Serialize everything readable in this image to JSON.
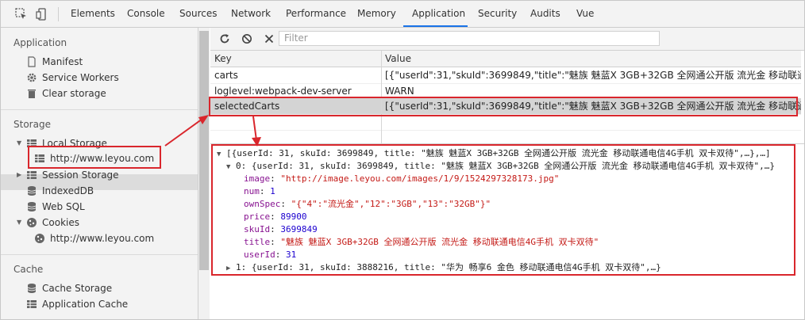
{
  "topbar": {
    "tabs": [
      "Elements",
      "Console",
      "Sources",
      "Network",
      "Performance",
      "Memory",
      "Application",
      "Security",
      "Audits",
      "Vue"
    ],
    "active_tab": "Application"
  },
  "sidebar": {
    "application": {
      "title": "Application",
      "items": [
        "Manifest",
        "Service Workers",
        "Clear storage"
      ]
    },
    "storage": {
      "title": "Storage",
      "local_storage": "Local Storage",
      "local_storage_origin": "http://www.leyou.com",
      "session_storage": "Session Storage",
      "indexeddb": "IndexedDB",
      "websql": "Web SQL",
      "cookies": "Cookies",
      "cookies_origin": "http://www.leyou.com"
    },
    "cache": {
      "title": "Cache",
      "items": [
        "Cache Storage",
        "Application Cache"
      ]
    }
  },
  "toolbar": {
    "filter_placeholder": "Filter"
  },
  "table": {
    "headers": {
      "key": "Key",
      "value": "Value"
    },
    "rows": [
      {
        "key": "carts",
        "value": "[{\"userId\":31,\"skuId\":3699849,\"title\":\"魅族 魅蓝X 3GB+32GB 全网通公开版 流光金 移动联通电信4G"
      },
      {
        "key": "loglevel:webpack-dev-server",
        "value": "WARN"
      },
      {
        "key": "selectedCarts",
        "value": "[{\"userId\":31,\"skuId\":3699849,\"title\":\"魅族 魅蓝X 3GB+32GB 全网通公开版 流光金 移动联通电信4G"
      }
    ],
    "selected_row": 2
  },
  "preview": {
    "root": "[{userId: 31, skuId: 3699849, title: \"魅族 魅蓝X 3GB+32GB 全网通公开版 流光金 移动联通电信4G手机 双卡双待\",…},…]",
    "item0_header": "0: {userId: 31, skuId: 3699849, title: \"魅族 魅蓝X 3GB+32GB 全网通公开版 流光金 移动联通电信4G手机 双卡双待\",…}",
    "fields": [
      {
        "key": "image",
        "value": "\"http://image.leyou.com/images/1/9/1524297328173.jpg\"",
        "kind": "string"
      },
      {
        "key": "num",
        "value": "1",
        "kind": "number"
      },
      {
        "key": "ownSpec",
        "value": "\"{\"4\":\"流光金\",\"12\":\"3GB\",\"13\":\"32GB\"}\"",
        "kind": "string"
      },
      {
        "key": "price",
        "value": "89900",
        "kind": "number"
      },
      {
        "key": "skuId",
        "value": "3699849",
        "kind": "number"
      },
      {
        "key": "title",
        "value": "\"魅族 魅蓝X 3GB+32GB 全网通公开版 流光金 移动联通电信4G手机 双卡双待\"",
        "kind": "string"
      },
      {
        "key": "userId",
        "value": "31",
        "kind": "number"
      }
    ],
    "item1_header": "1: {userId: 31, skuId: 3888216, title: \"华为 畅享6 金色 移动联通电信4G手机 双卡双待\",…}"
  },
  "colors": {
    "accent": "#1a73e8",
    "highlight": "#d9262c",
    "key": "#881391",
    "string": "#c41a16",
    "number": "#1c00cf"
  }
}
